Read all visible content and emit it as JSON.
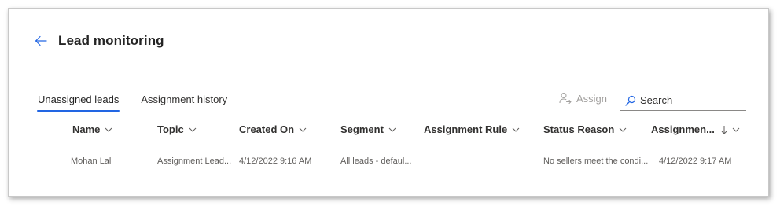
{
  "header": {
    "title": "Lead monitoring"
  },
  "tabs": [
    {
      "label": "Unassigned leads",
      "active": true
    },
    {
      "label": "Assignment history",
      "active": false
    }
  ],
  "toolbar": {
    "assign_label": "Assign",
    "search_placeholder": "Search"
  },
  "grid": {
    "columns": [
      "Name",
      "Topic",
      "Created On",
      "Segment",
      "Assignment Rule",
      "Status Reason",
      "Assignmen..."
    ],
    "rows": [
      {
        "name": "Mohan Lal",
        "topic": "Assignment Lead...",
        "created_on": "4/12/2022 9:16 AM",
        "segment": "All leads - defaul...",
        "assignment_rule": "",
        "status_reason": "No sellers meet the condi...",
        "assignment_date": "4/12/2022 9:17 AM"
      }
    ]
  },
  "colors": {
    "accent": "#2266e3",
    "text": "#242424",
    "muted": "#605e5c",
    "disabled": "#a19f9d"
  }
}
